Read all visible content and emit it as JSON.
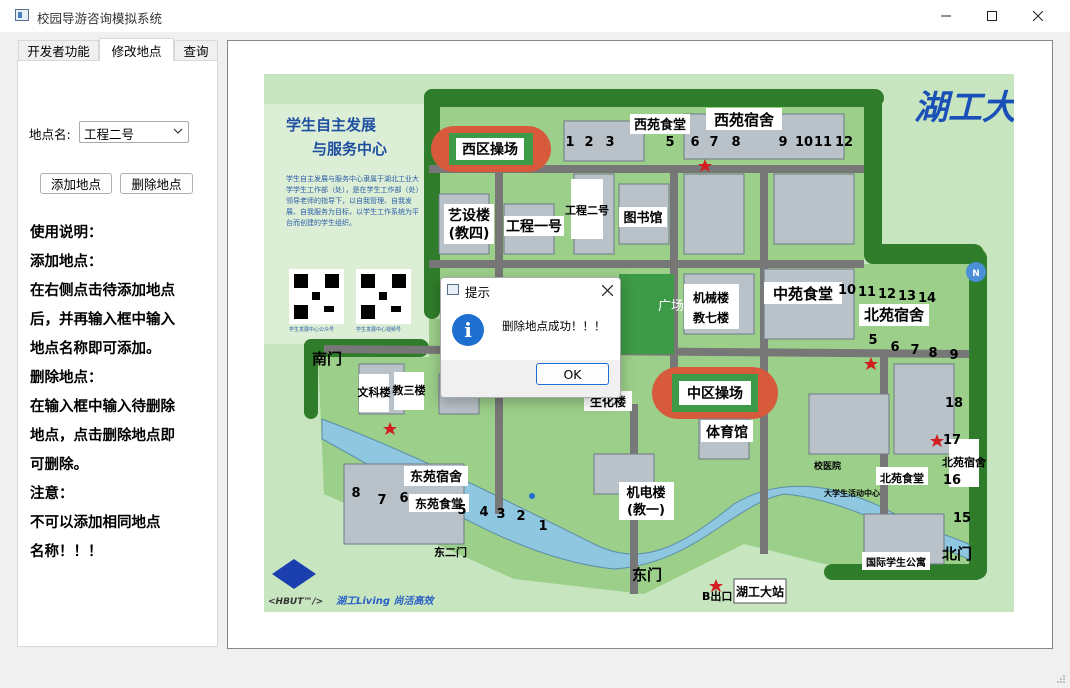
{
  "window": {
    "title": "校园导游咨询模拟系统",
    "minimize_icon": "minimize-icon",
    "maximize_icon": "maximize-icon",
    "close_icon": "close-icon"
  },
  "tabs": [
    {
      "label": "开发者功能",
      "active": false
    },
    {
      "label": "修改地点",
      "active": true
    },
    {
      "label": "查询",
      "active": false
    }
  ],
  "form": {
    "location_label": "地点名:",
    "location_value": "工程二号",
    "add_button": "添加地点",
    "delete_button": "删除地点"
  },
  "instructions": [
    "使用说明：",
    "添加地点：",
    "在右侧点击待添加地点",
    "后，并再输入框中输入",
    "地点名称即可添加。",
    "删除地点：",
    "在输入框中输入待删除",
    "地点，点击删除地点即",
    "可删除。",
    "注意：",
    "不可以添加相同地点",
    "名称！！！"
  ],
  "map": {
    "labels": {
      "west_field": "西区操场",
      "west_canteen": "西苑食堂",
      "west_dorm": "西苑宿舍",
      "art_building": "艺设楼",
      "art_building_sub": "(教四)",
      "eng_one": "工程一号",
      "eng_two": "工程二号",
      "library": "图书馆",
      "plaza": "广场",
      "mech_building": "机械楼",
      "seventh_building": "教七楼",
      "central_canteen": "中苑食堂",
      "north_dorm": "北苑宿舍",
      "south_gate": "南门",
      "liberal_arts": "文科楼",
      "teach_three": "教三楼",
      "center_field": "中区操场",
      "gym": "体育馆",
      "east_dorm": "东苑宿舍",
      "east_canteen": "东苑食堂",
      "electro_building": "机电楼",
      "electro_building_sub": "(教一)",
      "east_two_gate": "东二门",
      "east_gate": "东门",
      "bus_station": "湖工大站",
      "b_exit": "B出口",
      "north_canteen": "北苑食堂",
      "north_court": "北苑宿舍",
      "north_gate": "北门",
      "intl_apartment": "国际学生公寓",
      "bio_building": "生化楼",
      "student_center_title_1": "学生自主发展",
      "student_center_title_2": "与服务中心",
      "big_title": "湖工大地图",
      "slogan": "湖工Living 尚活高效",
      "hbut": "<HBUT™/>",
      "qr_caption_1": "学生发展中心公众号",
      "qr_caption_2": "学生发展中心视频号",
      "student_center_desc": "学生自主发展与服务中心隶属于湖北工业大学学生工作部（处），是在学生工作部（处）领导老师的指导下，以自我管理、自我发展、自我服务为目标，以学生工作系统为平台而创建的学生组织。",
      "campus_hospital": "校医院",
      "activity_center": "大学生活动中心",
      "north_numbers": [
        "10",
        "11",
        "12",
        "13",
        "14",
        "5",
        "6",
        "7",
        "8",
        "9"
      ],
      "west_numbers": [
        "1",
        "2",
        "3",
        "4",
        "5",
        "6",
        "7",
        "8",
        "9",
        "10",
        "11",
        "12"
      ],
      "east_numbers": [
        "8",
        "7",
        "6",
        "5",
        "4",
        "3",
        "2",
        "1"
      ],
      "dorm_right": [
        "18",
        "17",
        "16",
        "15"
      ]
    }
  },
  "dialog": {
    "title": "提示",
    "message": "删除地点成功！！！",
    "ok_button": "OK",
    "info_icon": "info-icon"
  },
  "colors": {
    "map_background": "#c7e6c0",
    "tree_green": "#2f7d2a",
    "road": "#777777",
    "track": "#d85a3c",
    "field": "#3d9a46",
    "river": "#8fc7e0",
    "accent_blue": "#1f6fd0",
    "title_blue": "#1a4fb8"
  }
}
